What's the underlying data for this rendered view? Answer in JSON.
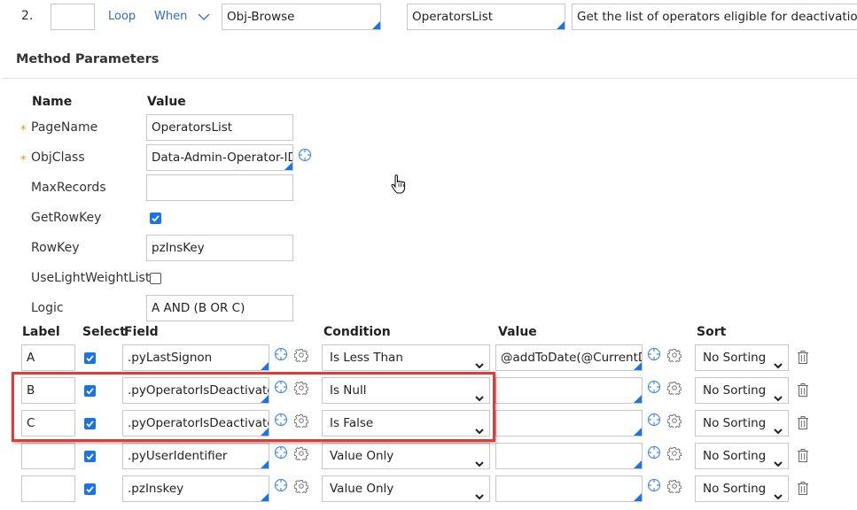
{
  "step": {
    "number": "2.",
    "label_value": "",
    "loop_link": "Loop",
    "when_link": "When",
    "method": "Obj-Browse",
    "step_page": "OperatorsList",
    "description": "Get the list of operators eligible for deactivation"
  },
  "section_title": "Method Parameters",
  "params": {
    "name_header": "Name",
    "value_header": "Value",
    "rows": [
      {
        "name": "PageName",
        "required": true,
        "type": "text",
        "value": "OperatorsList"
      },
      {
        "name": "ObjClass",
        "required": true,
        "type": "text",
        "value": "Data-Admin-Operator-ID"
      },
      {
        "name": "MaxRecords",
        "required": false,
        "type": "text",
        "value": ""
      },
      {
        "name": "GetRowKey",
        "required": false,
        "type": "checkbox",
        "checked": true
      },
      {
        "name": "RowKey",
        "required": false,
        "type": "text",
        "value": "pzInsKey"
      },
      {
        "name": "UseLightWeightList",
        "required": false,
        "type": "checkbox",
        "checked": false
      },
      {
        "name": "Logic",
        "required": false,
        "type": "text",
        "value": "A AND (B OR C)"
      }
    ],
    "required_marker": "*"
  },
  "criteria": {
    "headers": {
      "label": "Label",
      "select": "Select",
      "field": "Field",
      "condition": "Condition",
      "value": "Value",
      "sort": "Sort"
    },
    "rows": [
      {
        "label": "A",
        "selected": true,
        "field": ".pyLastSignon",
        "condition": "Is Less Than",
        "value": "@addToDate(@CurrentDateTime()",
        "sort": "No Sorting",
        "highlighted": false
      },
      {
        "label": "B",
        "selected": true,
        "field": ".pyOperatorIsDeactivated",
        "condition": "Is Null",
        "value": "",
        "sort": "No Sorting",
        "highlighted": true
      },
      {
        "label": "C",
        "selected": true,
        "field": ".pyOperatorIsDeactivated",
        "condition": "Is False",
        "value": "",
        "sort": "No Sorting",
        "highlighted": true
      },
      {
        "label": "",
        "selected": true,
        "field": ".pyUserIdentifier",
        "condition": "Value Only",
        "value": "",
        "sort": "No Sorting",
        "highlighted": false
      },
      {
        "label": "",
        "selected": true,
        "field": ".pzInskey",
        "condition": "Value Only",
        "value": "",
        "sort": "No Sorting",
        "highlighted": false
      }
    ]
  },
  "colors": {
    "accent": "#1a73e8",
    "link": "#2d6cc9",
    "required": "#e8921c",
    "highlight_border": "#e53935"
  },
  "cursor": "hand-pointer"
}
